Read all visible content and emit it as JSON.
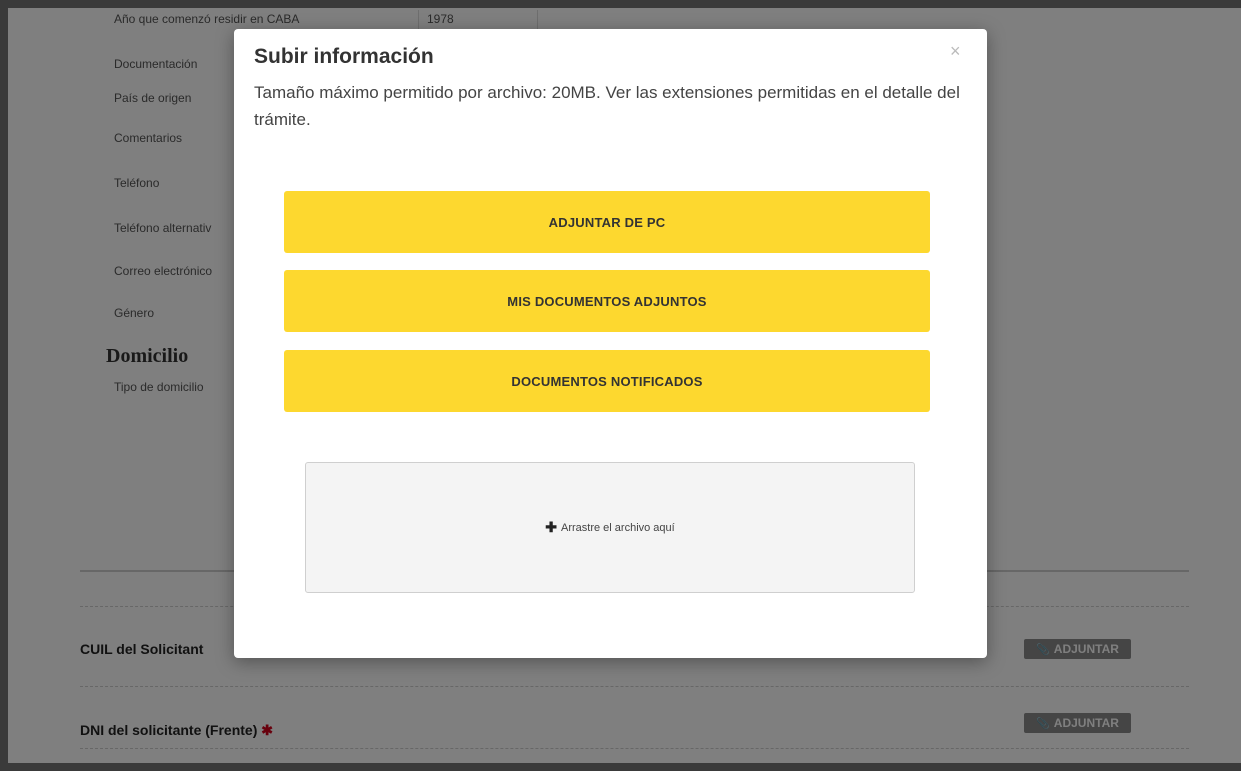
{
  "background_form": {
    "fields": [
      {
        "label": "Año que comenzó residir en CABA",
        "value": "1978"
      },
      {
        "label": "Documentación"
      },
      {
        "label": "País de origen"
      },
      {
        "label": "Comentarios"
      },
      {
        "label": "Teléfono"
      },
      {
        "label": "Teléfono alternativ"
      },
      {
        "label": "Correo electrónico"
      },
      {
        "label": "Género"
      }
    ],
    "section_title": "Domicilio",
    "address_type_label": "Tipo de domicilio",
    "documents": [
      {
        "label": "CUIL del Solicitant",
        "attach_label": "ADJUNTAR"
      },
      {
        "label": "DNI del solicitante (Frente)",
        "required_mark": "✱",
        "attach_label": "ADJUNTAR"
      }
    ]
  },
  "modal": {
    "title": "Subir información",
    "close_glyph": "×",
    "description": "Tamaño máximo permitido por archivo: 20MB. Ver las extensiones permitidas en el detalle del trámite.",
    "buttons": [
      {
        "label": "ADJUNTAR DE PC"
      },
      {
        "label": "MIS DOCUMENTOS ADJUNTOS"
      },
      {
        "label": "DOCUMENTOS NOTIFICADOS"
      }
    ],
    "dropzone": {
      "icon_glyph": "✚",
      "label": "Arrastre el archivo aquí"
    }
  },
  "colors": {
    "accent_yellow": "#fdd82f",
    "overlay": "rgba(0,0,0,0.5)",
    "attach_button": "#8a8a8a",
    "required_red": "#d0021b"
  },
  "icons": {
    "close": "close-icon",
    "plus": "plus-icon",
    "attach": "paperclip-icon"
  }
}
